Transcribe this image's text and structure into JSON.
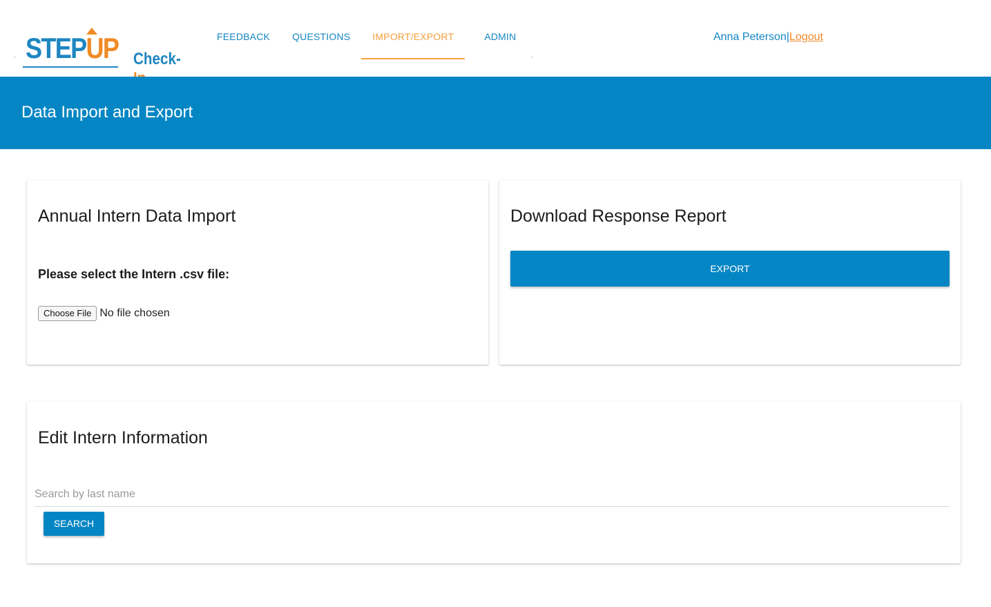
{
  "header": {
    "logo": {
      "step": "STEP",
      "up": "UP",
      "check": "Check-",
      "in": "In"
    },
    "nav": [
      {
        "label": "FEEDBACK"
      },
      {
        "label": "QUESTIONS"
      },
      {
        "label": "IMPORT/EXPORT",
        "active": true
      },
      {
        "label": "ADMIN"
      }
    ],
    "user": {
      "name": "Anna Peterson",
      "separator": "|",
      "logout": "Logout"
    }
  },
  "banner": {
    "title": "Data Import and Export"
  },
  "import_card": {
    "title": "Annual Intern Data Import",
    "label": "Please select the Intern .csv file:",
    "file_button": "Choose File",
    "file_status": "No file chosen"
  },
  "export_card": {
    "title": "Download Response Report",
    "button": "EXPORT"
  },
  "edit_card": {
    "title": "Edit Intern Information",
    "search_placeholder": "Search by last name",
    "search_button": "SEARCH"
  },
  "colors": {
    "primary": "#0586c4",
    "accent": "#f4a03a",
    "nav_text": "#1486c2"
  }
}
